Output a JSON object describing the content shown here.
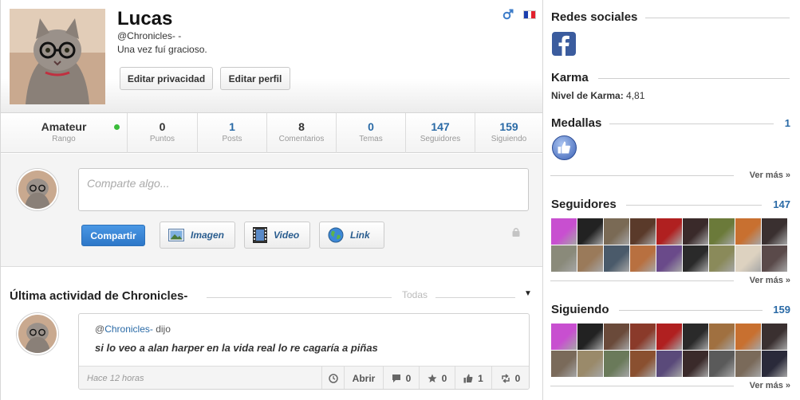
{
  "profile": {
    "name": "Lucas",
    "handle": "@Chronicles- -",
    "bio": "Una vez fuí gracioso.",
    "edit_privacy_label": "Editar privacidad",
    "edit_profile_label": "Editar perfil",
    "gender_icon": "male-icon",
    "flag_colors": [
      "#1a3fae",
      "#ffffff",
      "#e2202c"
    ]
  },
  "stats": [
    {
      "value": "Amateur",
      "label": "Rango"
    },
    {
      "value": "0",
      "label": "Puntos"
    },
    {
      "value": "1",
      "label": "Posts"
    },
    {
      "value": "8",
      "label": "Comentarios"
    },
    {
      "value": "0",
      "label": "Temas"
    },
    {
      "value": "147",
      "label": "Seguidores"
    },
    {
      "value": "159",
      "label": "Siguiendo"
    }
  ],
  "composer": {
    "placeholder": "Comparte algo...",
    "share_label": "Compartir",
    "image_label": "Imagen",
    "video_label": "Video",
    "link_label": "Link"
  },
  "activity": {
    "title": "Última actividad de Chronicles-",
    "filter": "Todas",
    "post": {
      "prefix": "@",
      "user": "Chronicles-",
      "suffix": " dijo",
      "text": "si lo veo a alan harper en la vida real lo re cagaría a piñas",
      "time": "Hace 12 horas",
      "open_label": "Abrir",
      "comments": "0",
      "favorites": "0",
      "likes": "1",
      "shares": "0"
    }
  },
  "sidebar": {
    "social_title": "Redes sociales",
    "karma_title": "Karma",
    "karma_label": "Nivel de Karma:",
    "karma_value": "4,81",
    "medals_title": "Medallas",
    "medals_count": "1",
    "followers_title": "Seguidores",
    "followers_count": "147",
    "following_title": "Siguiendo",
    "following_count": "159",
    "see_more": "Ver más »"
  },
  "colors": {
    "accent_blue": "#2a6aa6",
    "share_button": "#2d77c8",
    "online_dot": "#3bbd3b",
    "facebook": "#3b5c9e"
  },
  "follower_thumbs": [
    "#c84fd0",
    "#222222",
    "#7a6a55",
    "#5a3a2a",
    "#b02020",
    "#3a2a2a",
    "#6b7a3a",
    "#c87030",
    "#3a3030",
    "#8a8a7a",
    "#9a7a5a",
    "#4a5a6a",
    "#b87040",
    "#6a4a8a",
    "#2a2a2a",
    "#8a8a5a",
    "#ddd2c0",
    "#5a4a4a"
  ],
  "following_thumbs": [
    "#c84fd0",
    "#222222",
    "#6a4a3a",
    "#8a3a2a",
    "#b02020",
    "#2a2a2a",
    "#a07040",
    "#c87030",
    "#3a3030",
    "#7a6a5a",
    "#9a8a6a",
    "#6a7a5a",
    "#8a5030",
    "#5a4a7a",
    "#3a2a2a",
    "#5a5a5a",
    "#7a6a5a",
    "#2a2a3a"
  ]
}
